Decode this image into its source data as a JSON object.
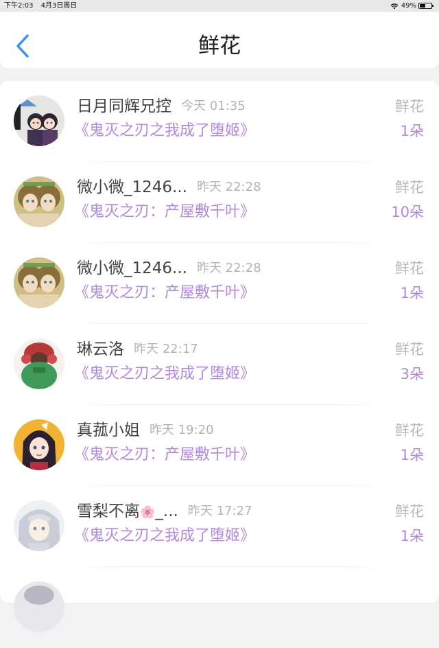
{
  "status_bar": {
    "time": "下午2:03",
    "date": "4月3日周日",
    "battery": "49%",
    "battery_level": 0.49
  },
  "header": {
    "title": "鲜花",
    "back_icon": "chevron-left-icon",
    "accent_color": "#2f8ff0"
  },
  "colors": {
    "book_title": "#b387dd",
    "timestamp": "#b3b3b3",
    "gift_label": "#b9b9b9"
  },
  "items": [
    {
      "name": "日月同辉兄控",
      "time": "今天 01:35",
      "book": "《鬼灭之刃之我成了堕姬》",
      "gift": "鲜花",
      "count": "1朵"
    },
    {
      "name": "微小微_1246...",
      "time": "昨天 22:28",
      "book": "《鬼灭之刃：产屋敷千叶》",
      "gift": "鲜花",
      "count": "10朵"
    },
    {
      "name": "微小微_1246...",
      "time": "昨天 22:28",
      "book": "《鬼灭之刃：产屋敷千叶》",
      "gift": "鲜花",
      "count": "1朵"
    },
    {
      "name": "琳云洛",
      "time": "昨天 22:17",
      "book": "《鬼灭之刃之我成了堕姬》",
      "gift": "鲜花",
      "count": "3朵"
    },
    {
      "name": "真菰小姐",
      "time": "昨天 19:20",
      "book": "《鬼灭之刃：产屋敷千叶》",
      "gift": "鲜花",
      "count": "1朵"
    },
    {
      "name": "雪梨不离",
      "name_emoji": "🌸",
      "name_suffix": "_...",
      "time": "昨天 17:27",
      "book": "《鬼灭之刃之我成了堕姬》",
      "gift": "鲜花",
      "count": "1朵"
    }
  ]
}
